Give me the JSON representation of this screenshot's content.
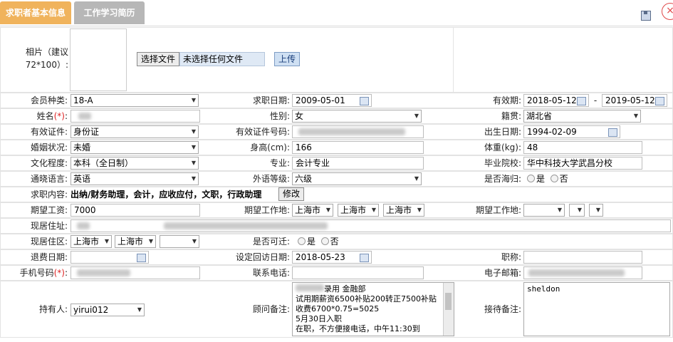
{
  "tabs": [
    "求职者基本信息",
    "工作学习简历"
  ],
  "photo": {
    "label": "相片（建议72*100）:",
    "choose_button": "选择文件",
    "no_file": "未选择任何文件",
    "upload_button": "上传"
  },
  "fields": {
    "member_type": {
      "label": "会员种类:",
      "value": "18-A"
    },
    "apply_date": {
      "label": "求职日期:",
      "value": "2009-05-01"
    },
    "valid_period": {
      "label": "有效期:",
      "from": "2018-05-12",
      "sep": "-",
      "to": "2019-05-12"
    },
    "name": {
      "label": "姓名",
      "req": "(*)",
      "colon": ":"
    },
    "gender": {
      "label": "性别:",
      "value": "女"
    },
    "native": {
      "label": "籍贯:",
      "value": "湖北省"
    },
    "id_type": {
      "label": "有效证件:",
      "value": "身份证"
    },
    "id_number": {
      "label": "有效证件号码:"
    },
    "birth": {
      "label": "出生日期:",
      "value": "1994-02-09"
    },
    "marital": {
      "label": "婚姻状况:",
      "value": "未婚"
    },
    "height": {
      "label": "身高(cm):",
      "value": "166"
    },
    "weight": {
      "label": "体重(kg):",
      "value": "48"
    },
    "education": {
      "label": "文化程度:",
      "value": "本科（全日制）"
    },
    "major": {
      "label": "专业:",
      "value": "会计专业"
    },
    "school": {
      "label": "毕业院校:",
      "value": "华中科技大学武昌分校"
    },
    "language": {
      "label": "通晓语言:",
      "value": "英语"
    },
    "lang_level": {
      "label": "外语等级:",
      "value": "六级"
    },
    "overseas": {
      "label": "是否海归:",
      "yes": "是",
      "no": "否"
    },
    "job_content": {
      "label": "求职内容:",
      "value": "出纳/财务助理，会计，应收应付，文职，行政助理",
      "button": "修改"
    },
    "salary": {
      "label": "期望工资:",
      "value": "7000"
    },
    "work_place": {
      "label": "期望工作地:",
      "v1": "上海市",
      "v2": "上海市",
      "v3": "上海市"
    },
    "work_place2": {
      "label": "期望工作地:"
    },
    "address": {
      "label": "现居住址:"
    },
    "district": {
      "label": "现居住区:",
      "v1": "上海市",
      "v2": "上海市"
    },
    "relocate": {
      "label": "是否可迁:",
      "yes": "是",
      "no": "否"
    },
    "refund_date": {
      "label": "退费日期:"
    },
    "revisit_date": {
      "label": "设定回访日期:",
      "value": "2018-05-23"
    },
    "title": {
      "label": "职称:"
    },
    "mobile": {
      "label": "手机号码",
      "req": "(*)",
      "colon": ":"
    },
    "phone": {
      "label": "联系电话:"
    },
    "email": {
      "label": "电子邮箱:"
    },
    "holder": {
      "label": "持有人:",
      "value": "yirui012"
    },
    "advisor_note": {
      "label": "顾问备注:",
      "lines": [
        "录用 金融部",
        "试用期薪资6500补贴200转正7500补贴",
        "收费6700*0.75=5025",
        "5月30日入职",
        "在职，不方便接电话，中午11:30到"
      ]
    },
    "reception_note": {
      "label": "接待备注:",
      "value": "sheldon"
    }
  }
}
